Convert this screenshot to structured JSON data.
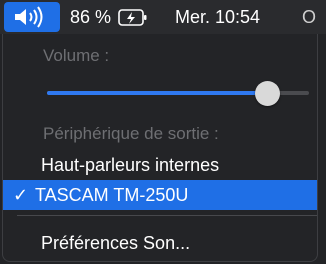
{
  "menubar": {
    "volume_icon": "speaker-volume-icon",
    "battery_percent": "86 %",
    "battery_icon": "battery-charging-icon",
    "clock": "Mer. 10:54",
    "overflow_glyph": "O"
  },
  "volume_menu": {
    "volume_label": "Volume :",
    "volume_level": 0.84,
    "output_label": "Périphérique de sortie :",
    "devices": [
      {
        "label": "Haut-parleurs internes",
        "selected": false
      },
      {
        "label": "TASCAM TM-250U",
        "selected": true
      }
    ],
    "checkmark": "✓",
    "preferences_label": "Préférences Son..."
  },
  "colors": {
    "accent": "#1f6fe6",
    "slider_fill": "#2f79f0",
    "panel_bg": "#232427",
    "disabled_text": "#6e6f73"
  }
}
